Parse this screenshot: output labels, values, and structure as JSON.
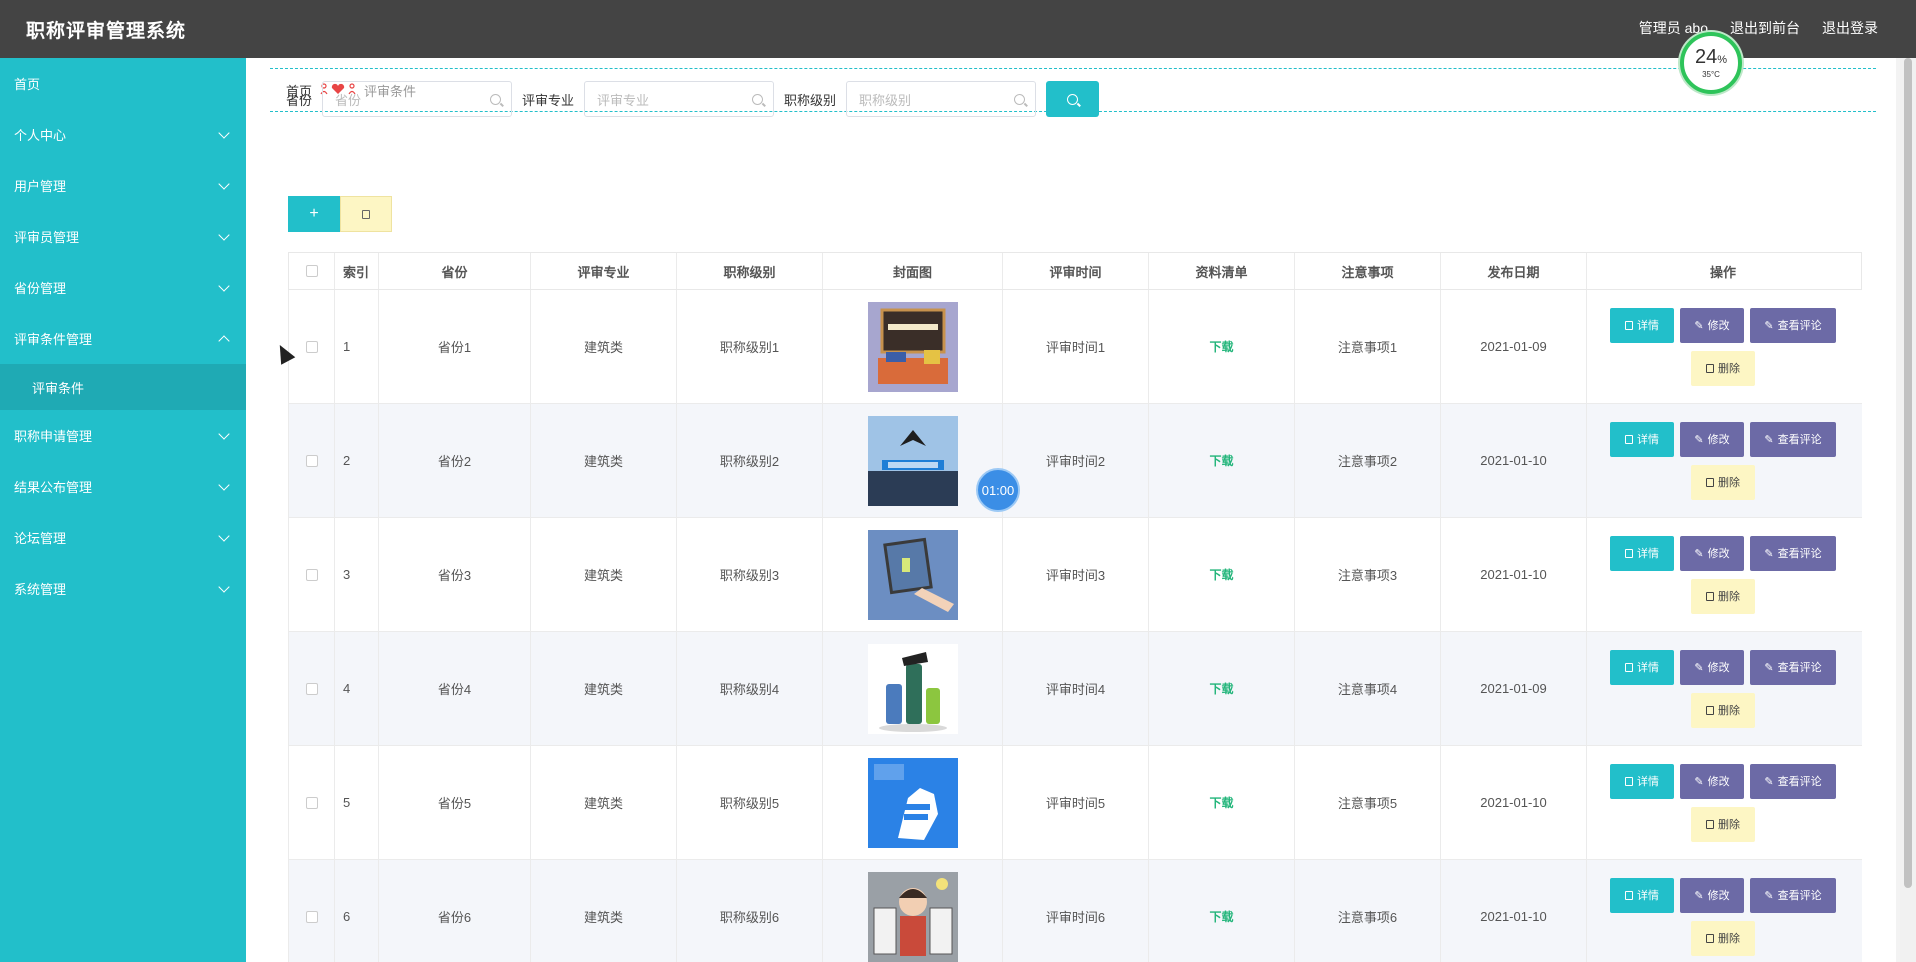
{
  "app": {
    "title": "职称评审管理系统",
    "user_label": "管理员 abo",
    "to_front": "退出到前台",
    "logout": "退出登录"
  },
  "sidebar": {
    "items": [
      {
        "label": "首页",
        "has_children": false
      },
      {
        "label": "个人中心",
        "has_children": true
      },
      {
        "label": "用户管理",
        "has_children": true
      },
      {
        "label": "评审员管理",
        "has_children": true
      },
      {
        "label": "省份管理",
        "has_children": true
      },
      {
        "label": "评审条件管理",
        "has_children": true,
        "expanded": true
      },
      {
        "label": "评审条件",
        "sub": true
      },
      {
        "label": "职称申请管理",
        "has_children": true
      },
      {
        "label": "结果公布管理",
        "has_children": true
      },
      {
        "label": "论坛管理",
        "has_children": true
      },
      {
        "label": "系统管理",
        "has_children": true
      }
    ]
  },
  "breadcrumb": {
    "home": "首页",
    "separator_icon": "heart-people-icon",
    "current": "评审条件"
  },
  "search": {
    "province_label": "省份",
    "province_placeholder": "省份",
    "major_label": "评审专业",
    "major_placeholder": "评审专业",
    "level_label": "职称级别",
    "level_placeholder": "职称级别"
  },
  "toolbar": {
    "add": "+",
    "delete_icon": "trash-icon"
  },
  "table": {
    "headers": [
      "索引",
      "省份",
      "评审专业",
      "职称级别",
      "封面图",
      "评审时间",
      "资料清单",
      "注意事项",
      "发布日期",
      "操作"
    ],
    "rows": [
      {
        "index": "1",
        "province": "省份1",
        "major": "建筑类",
        "level": "职称级别1",
        "time": "评审时间1",
        "download": "下载",
        "note": "注意事项1",
        "date": "2021-01-09"
      },
      {
        "index": "2",
        "province": "省份2",
        "major": "建筑类",
        "level": "职称级别2",
        "time": "评审时间2",
        "download": "下载",
        "note": "注意事项2",
        "date": "2021-01-10"
      },
      {
        "index": "3",
        "province": "省份3",
        "major": "建筑类",
        "level": "职称级别3",
        "time": "评审时间3",
        "download": "下载",
        "note": "注意事项3",
        "date": "2021-01-10"
      },
      {
        "index": "4",
        "province": "省份4",
        "major": "建筑类",
        "level": "职称级别4",
        "time": "评审时间4",
        "download": "下载",
        "note": "注意事项4",
        "date": "2021-01-09"
      },
      {
        "index": "5",
        "province": "省份5",
        "major": "建筑类",
        "level": "职称级别5",
        "time": "评审时间5",
        "download": "下载",
        "note": "注意事项5",
        "date": "2021-01-10"
      },
      {
        "index": "6",
        "province": "省份6",
        "major": "建筑类",
        "level": "职称级别6",
        "time": "评审时间6",
        "download": "下载",
        "note": "注意事项6",
        "date": "2021-01-10"
      }
    ],
    "actions": {
      "detail": "详情",
      "edit": "修改",
      "review": "查看评论",
      "delete": "删除"
    }
  },
  "overlay": {
    "gauge_value": "24",
    "gauge_unit": "%",
    "temperature": "35°C",
    "timer": "01:00"
  },
  "colors": {
    "accent": "#22bfca",
    "topbar": "#444444",
    "purple_button": "#6c6aa6",
    "delete_button": "#fdf6c4",
    "download_text": "#22b57a"
  }
}
